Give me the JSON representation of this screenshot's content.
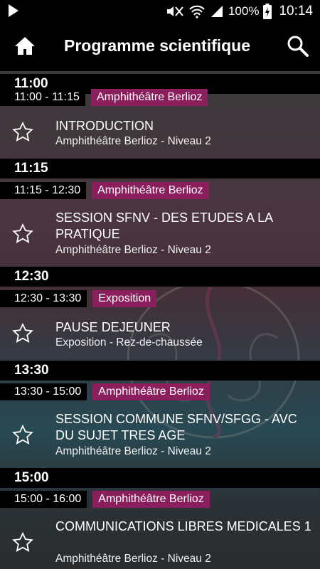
{
  "status_bar": {
    "battery": "100%",
    "time": "10:14"
  },
  "app_bar": {
    "title": "Programme scientifique"
  },
  "sections": [
    {
      "header": "11:00",
      "time_range": "11:00 - 11:15",
      "room": "Amphithéâtre Berlioz",
      "title": "INTRODUCTION",
      "location": "Amphithéâtre Berlioz  - Niveau 2"
    },
    {
      "header": "11:15",
      "time_range": "11:15 - 12:30",
      "room": "Amphithéâtre Berlioz",
      "title": "SESSION SFNV - DES ETUDES A LA PRATIQUE",
      "location": "Amphithéâtre Berlioz  - Niveau 2"
    },
    {
      "header": "12:30",
      "time_range": "12:30 - 13:30",
      "room": "Exposition",
      "title": "PAUSE DEJEUNER",
      "location": "Exposition - Rez-de-chaussée"
    },
    {
      "header": "13:30",
      "time_range": "13:30 - 15:00",
      "room": "Amphithéâtre Berlioz",
      "title": "SESSION COMMUNE SFNV/SFGG - AVC DU SUJET TRES AGE",
      "location": "Amphithéâtre Berlioz  - Niveau 2"
    },
    {
      "header": "15:00",
      "time_range": "15:00 - 16:00",
      "room": "Amphithéâtre Berlioz",
      "title": "COMMUNICATIONS LIBRES MEDICALES 1",
      "location": "Amphithéâtre Berlioz  - Niveau 2"
    }
  ],
  "colors": {
    "room_badge": "#8b1f5e",
    "header_bg": "#000000"
  }
}
